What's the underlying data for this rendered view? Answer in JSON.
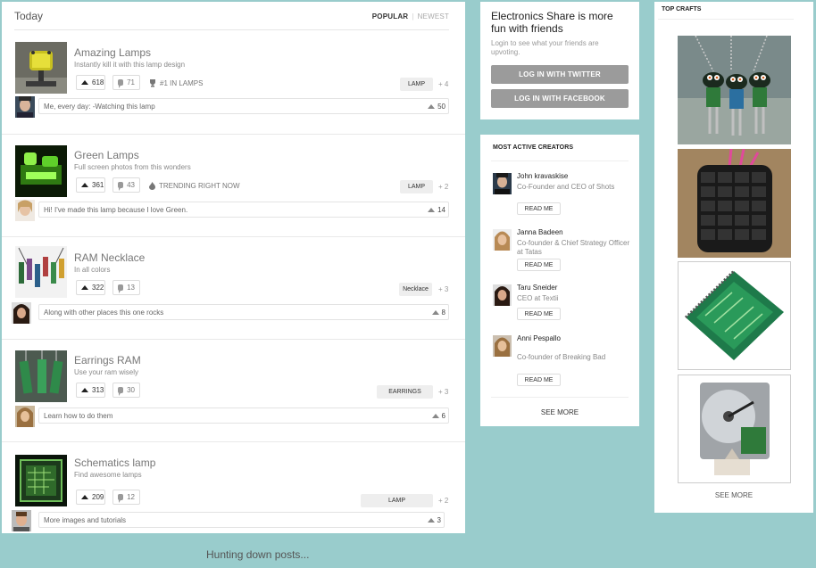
{
  "feed": {
    "title": "Today",
    "sort_popular": "POPULAR",
    "sort_newest": "NEWEST",
    "posts": [
      {
        "title": "Amazing Lamps",
        "subtitle": "Instantly kill it with this lamp design",
        "votes": "618",
        "comments": "71",
        "meta_icon": "trophy-icon",
        "meta": "#1 IN LAMPS",
        "tag": "LAMP",
        "more": "+ 4",
        "comment_text": "Me, every day: -Watching this lamp",
        "comment_votes": "50"
      },
      {
        "title": "Green Lamps",
        "subtitle": "Full screen photos from this wonders",
        "votes": "361",
        "comments": "43",
        "meta_icon": "flame-icon",
        "meta": "TRENDING RIGHT NOW",
        "tag": "LAMP",
        "more": "+ 2",
        "comment_text": "Hi! I've made this lamp because I love Green.",
        "comment_votes": "14"
      },
      {
        "title": "RAM Necklace",
        "subtitle": "In all colors",
        "votes": "322",
        "comments": "13",
        "meta": "",
        "tag": "Necklace",
        "more": "+ 3",
        "comment_text": "Along with other places this one rocks",
        "comment_votes": "8"
      },
      {
        "title": "Earrings RAM",
        "subtitle": "Use your ram wisely",
        "votes": "313",
        "comments": "30",
        "meta": "",
        "tag": "EARRINGS",
        "more": "+ 3",
        "comment_text": "Learn how to do them",
        "comment_votes": "6"
      },
      {
        "title": "Schematics lamp",
        "subtitle": "Find awesome lamps",
        "votes": "209",
        "comments": "12",
        "meta": "",
        "tag": "LAMP",
        "more": "+ 2",
        "comment_text": "More images and tutorials",
        "comment_votes": "3"
      }
    ],
    "loading_text": "Hunting down posts..."
  },
  "share": {
    "title": "Electronics Share is more fun with friends",
    "subtitle": "Login to see what your friends are upvoting.",
    "twitter_label": "LOG IN WITH TWITTER",
    "facebook_label": "LOG IN WITH FACEBOOK"
  },
  "creators": {
    "heading": "MOST ACTIVE CREATORS",
    "read_label": "READ ME",
    "see_more": "SEE MORE",
    "items": [
      {
        "name": "John kravaskise",
        "role": "Co-Founder and CEO of Shots"
      },
      {
        "name": "Janna Badeen",
        "role": "Co-founder & Chief Strategy Officer at Tatas"
      },
      {
        "name": "Taru Sneider",
        "role": "CEO at Textii"
      },
      {
        "name": "Anni Pespallo",
        "role": "Co-founder of Breaking Bad"
      }
    ]
  },
  "crafts": {
    "heading": "TOP CRAFTS",
    "see_more": "SEE MORE"
  },
  "colors": {
    "page_background": "#99cccc",
    "panel": "#ffffff",
    "login_button": "#9b9b9b"
  }
}
